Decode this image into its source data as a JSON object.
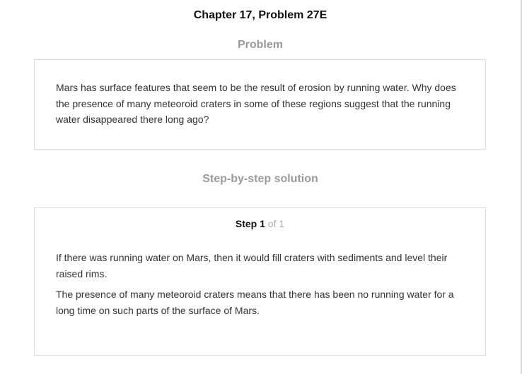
{
  "header": {
    "title": "Chapter 17, Problem 27E"
  },
  "problem": {
    "heading": "Problem",
    "text": "Mars has surface features that seem to be the result of erosion by running water. Why does the presence of many meteoroid craters in some of these regions suggest that the running water disappeared there long ago?"
  },
  "solution": {
    "heading": "Step-by-step solution",
    "step": {
      "word": "Step",
      "number": "1",
      "of_total": "of 1"
    },
    "paragraphs": [
      "If there was running water on Mars, then it would fill craters with sediments and level their raised rims.",
      "The presence of many meteoroid craters means that there has been no running water for a long time on such parts of the surface of Mars."
    ]
  },
  "colors": {
    "heading_gray": "#9a9a9a",
    "card_border": "#dcdcdc",
    "text": "#333333",
    "step_of_gray": "#aaaaaa"
  }
}
